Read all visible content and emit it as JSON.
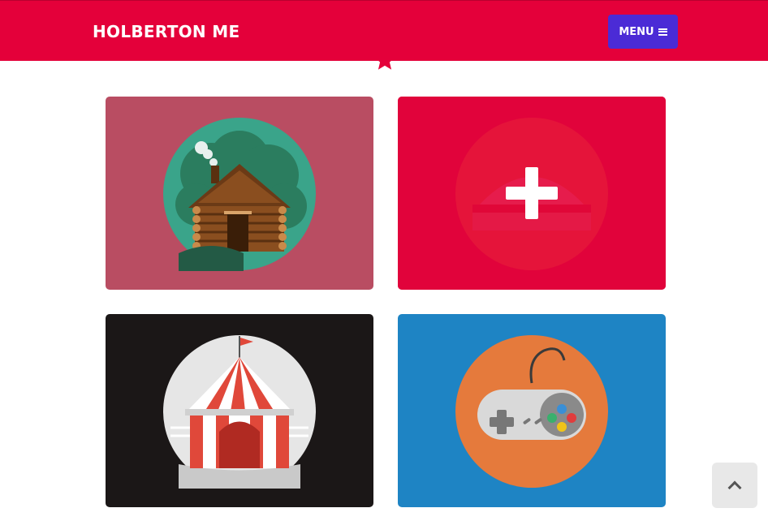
{
  "navbar": {
    "brand": "HOLBERTON ME",
    "menu_label": "MENU",
    "menu_icon": "bars-icon",
    "color": "#e4003a",
    "menu_color": "#4b2bd6"
  },
  "divider_icon": "star-icon",
  "portfolio": {
    "items": [
      {
        "name": "cabin",
        "icon": "cabin-icon",
        "background": "#b94d62"
      },
      {
        "name": "cake",
        "icon": "cake-icon",
        "background": "#cf1a45",
        "hovered": true,
        "hover_icon": "plus-icon"
      },
      {
        "name": "circus",
        "icon": "circus-tent-icon",
        "background": "#1b1717"
      },
      {
        "name": "game",
        "icon": "game-controller-icon",
        "background": "#1e84c4"
      }
    ]
  },
  "scroll_top": {
    "icon": "chevron-up-icon"
  }
}
